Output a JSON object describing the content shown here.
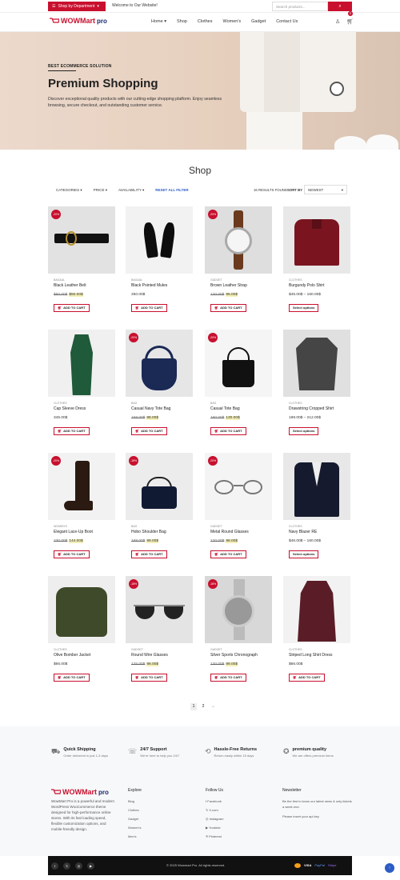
{
  "topbar": {
    "dept_label": "Shop by Department",
    "welcome": "Welcome to Our Website!",
    "search_placeholder": "Search products..."
  },
  "nav": {
    "logo_main": "WOWMart",
    "logo_suffix": "pro",
    "menu": [
      "Home",
      "Shop",
      "Clothes",
      "Women's",
      "Gadget",
      "Contact Us"
    ],
    "cart_count": "0"
  },
  "hero": {
    "tag": "BEST ECOMMERCE SOLUTION",
    "title": "Premium Shopping",
    "desc": "Discover exceptional quality products with our cutting-edge shopping platform. Enjoy seamless browsing, secure checkout, and outstanding customer service."
  },
  "shop": {
    "title": "Shop",
    "filters": [
      "CATEGORIES",
      "PRICE",
      "AVAILABILITY"
    ],
    "reset": "RESET ALL FILTER",
    "results": "16 RESULTS FOUND",
    "sort_label": "SORT BY",
    "sort_value": "NEWEST"
  },
  "products": [
    {
      "cat": "BAG&AL",
      "name": "Black Leather Belt",
      "old": "$60.00$",
      "new": "$50.00$",
      "sale": "-20%",
      "btn": "ADD TO CART"
    },
    {
      "cat": "BAG&AL",
      "name": "Black Pointed Mules",
      "old": "",
      "new": "250.00$",
      "sale": "",
      "btn": "ADD TO CART"
    },
    {
      "cat": "GADGET",
      "name": "Brown Leather Strap",
      "old": "120.00$",
      "new": "95.00$",
      "sale": "-20%",
      "btn": "ADD TO CART"
    },
    {
      "cat": "CLOTHES",
      "name": "Burgundy Polo Shirt",
      "old": "",
      "new": "$45.00$ – 160.00$",
      "sale": "",
      "btn": "Select options"
    },
    {
      "cat": "CLOTHES",
      "name": "Cap Sleeve Dress",
      "old": "",
      "new": "345.00$",
      "sale": "",
      "btn": "ADD TO CART"
    },
    {
      "cat": "BAG",
      "name": "Casual Navy Tote Bag",
      "old": "159.00$",
      "new": "88.00$",
      "sale": "-20%",
      "btn": "ADD TO CART"
    },
    {
      "cat": "BAG",
      "name": "Casual Tote Bag",
      "old": "160.00$",
      "new": "130.00$",
      "sale": "-20%",
      "btn": "ADD TO CART"
    },
    {
      "cat": "CLOTHES",
      "name": "Drawstring Cropped Shirt",
      "old": "",
      "new": "198.00$ – 212.00$",
      "sale": "",
      "btn": "Select options"
    },
    {
      "cat": "WOMEN'S",
      "name": "Elegant Lace-Up Boot",
      "old": "230.00$",
      "new": "144.00$",
      "sale": "-20%",
      "btn": "ADD TO CART"
    },
    {
      "cat": "BAG",
      "name": "Hobo Shoulder Bag",
      "old": "169.00$",
      "new": "99.00$",
      "sale": "-18%",
      "btn": "ADD TO CART"
    },
    {
      "cat": "GADGET",
      "name": "Metal Round Glasses",
      "old": "120.00$",
      "new": "98.00$",
      "sale": "-20%",
      "btn": "ADD TO CART"
    },
    {
      "cat": "CLOTHES",
      "name": "Navy Blazer RE",
      "old": "",
      "new": "$46.00$ – 160.00$",
      "sale": "",
      "btn": "Select options"
    },
    {
      "cat": "CLOTHES",
      "name": "Olive Bomber Jacket",
      "old": "",
      "new": "$66.00$",
      "sale": "",
      "btn": "ADD TO CART"
    },
    {
      "cat": "GADGET",
      "name": "Round Wire Glasses",
      "old": "125.00$",
      "new": "98.00$",
      "sale": "-18%",
      "btn": "ADD TO CART"
    },
    {
      "cat": "GADGET",
      "name": "Silver Sports Chronograph",
      "old": "120.00$",
      "new": "99.00$",
      "sale": "-18%",
      "btn": "ADD TO CART"
    },
    {
      "cat": "CLOTHES",
      "name": "Striped Long Shirt Dress",
      "old": "",
      "new": "$66.00$",
      "sale": "",
      "btn": "ADD TO CART"
    }
  ],
  "pager": {
    "p1": "1",
    "p2": "2",
    "next": "→"
  },
  "features": [
    {
      "title": "Quick Shipping",
      "desc": "Order delivered in just 1-3 days"
    },
    {
      "title": "24/7 Support",
      "desc": "We're here to help you 24/7"
    },
    {
      "title": "Hassle-Free Returns",
      "desc": "Return easily within 15 days"
    },
    {
      "title": "premium quality",
      "desc": "We are offers premium items"
    }
  ],
  "footer": {
    "desc": "WowMart Pro is a powerful and modern WordPress WooCommerce theme designed for high-performance online stores. With its fast loading speed, flexible customization options, and mobile-friendly design.",
    "explore_title": "Explore",
    "explore": [
      "Blog",
      "Clothes",
      "Gadget",
      "Women's",
      "Men's"
    ],
    "follow_title": "Follow Us",
    "follow": [
      "Facebook",
      "X.com",
      "Instagram",
      "Youtube",
      "Pinterest"
    ],
    "newsletter_title": "Newsletter",
    "newsletter_text": "Be the first to know our latest news & only tickets a week end.",
    "newsletter_link": "Please insert your api key"
  },
  "bottom": {
    "copyright": "© 2025 Wowmart Pro. All rights reserved.",
    "payments": [
      "VISA",
      "PayPal",
      "Stripe"
    ]
  }
}
